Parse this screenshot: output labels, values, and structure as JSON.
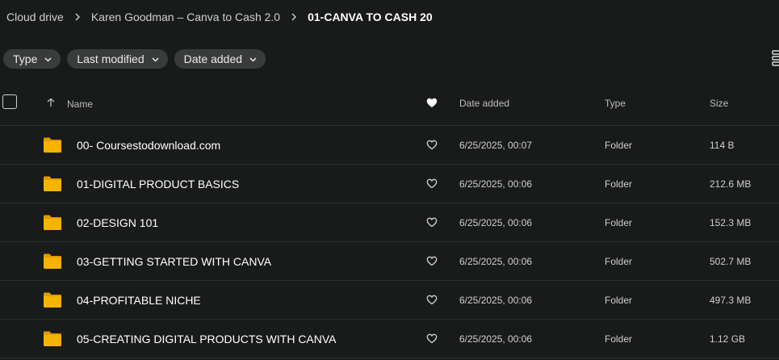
{
  "breadcrumb": {
    "items": [
      "Cloud drive",
      "Karen Goodman – Canva to Cash 2.0"
    ],
    "current": "01-CANVA TO CASH 20"
  },
  "filters": {
    "type_label": "Type",
    "modified_label": "Last modified",
    "added_label": "Date added"
  },
  "table": {
    "headers": {
      "name": "Name",
      "date_added": "Date added",
      "type": "Type",
      "size": "Size"
    },
    "rows": [
      {
        "name": "00- Coursestodownload.com",
        "date_added": "6/25/2025, 00:07",
        "type": "Folder",
        "size": "114 B"
      },
      {
        "name": "01-DIGITAL PRODUCT BASICS",
        "date_added": "6/25/2025, 00:06",
        "type": "Folder",
        "size": "212.6 MB"
      },
      {
        "name": "02-DESIGN 101",
        "date_added": "6/25/2025, 00:06",
        "type": "Folder",
        "size": "152.3 MB"
      },
      {
        "name": "03-GETTING STARTED WITH CANVA",
        "date_added": "6/25/2025, 00:06",
        "type": "Folder",
        "size": "502.7 MB"
      },
      {
        "name": "04-PROFITABLE NICHE",
        "date_added": "6/25/2025, 00:06",
        "type": "Folder",
        "size": "497.3 MB"
      },
      {
        "name": "05-CREATING DIGITAL PRODUCTS WITH CANVA",
        "date_added": "6/25/2025, 00:06",
        "type": "Folder",
        "size": "1.12 GB"
      }
    ]
  },
  "icons": {
    "folder": "folder-icon",
    "favorite": "heart-outline-icon",
    "favorite_header": "heart-filled-icon",
    "sort": "arrow-up-icon",
    "separator": "chevron-right-icon",
    "dropdown": "chevron-down-icon",
    "view": "list-view-icon"
  },
  "colors": {
    "background": "#191a1a",
    "chip": "#3a3b3b",
    "folder": "#f5b400",
    "folder_tab": "#e09a00",
    "divider": "#2e2f2f"
  }
}
